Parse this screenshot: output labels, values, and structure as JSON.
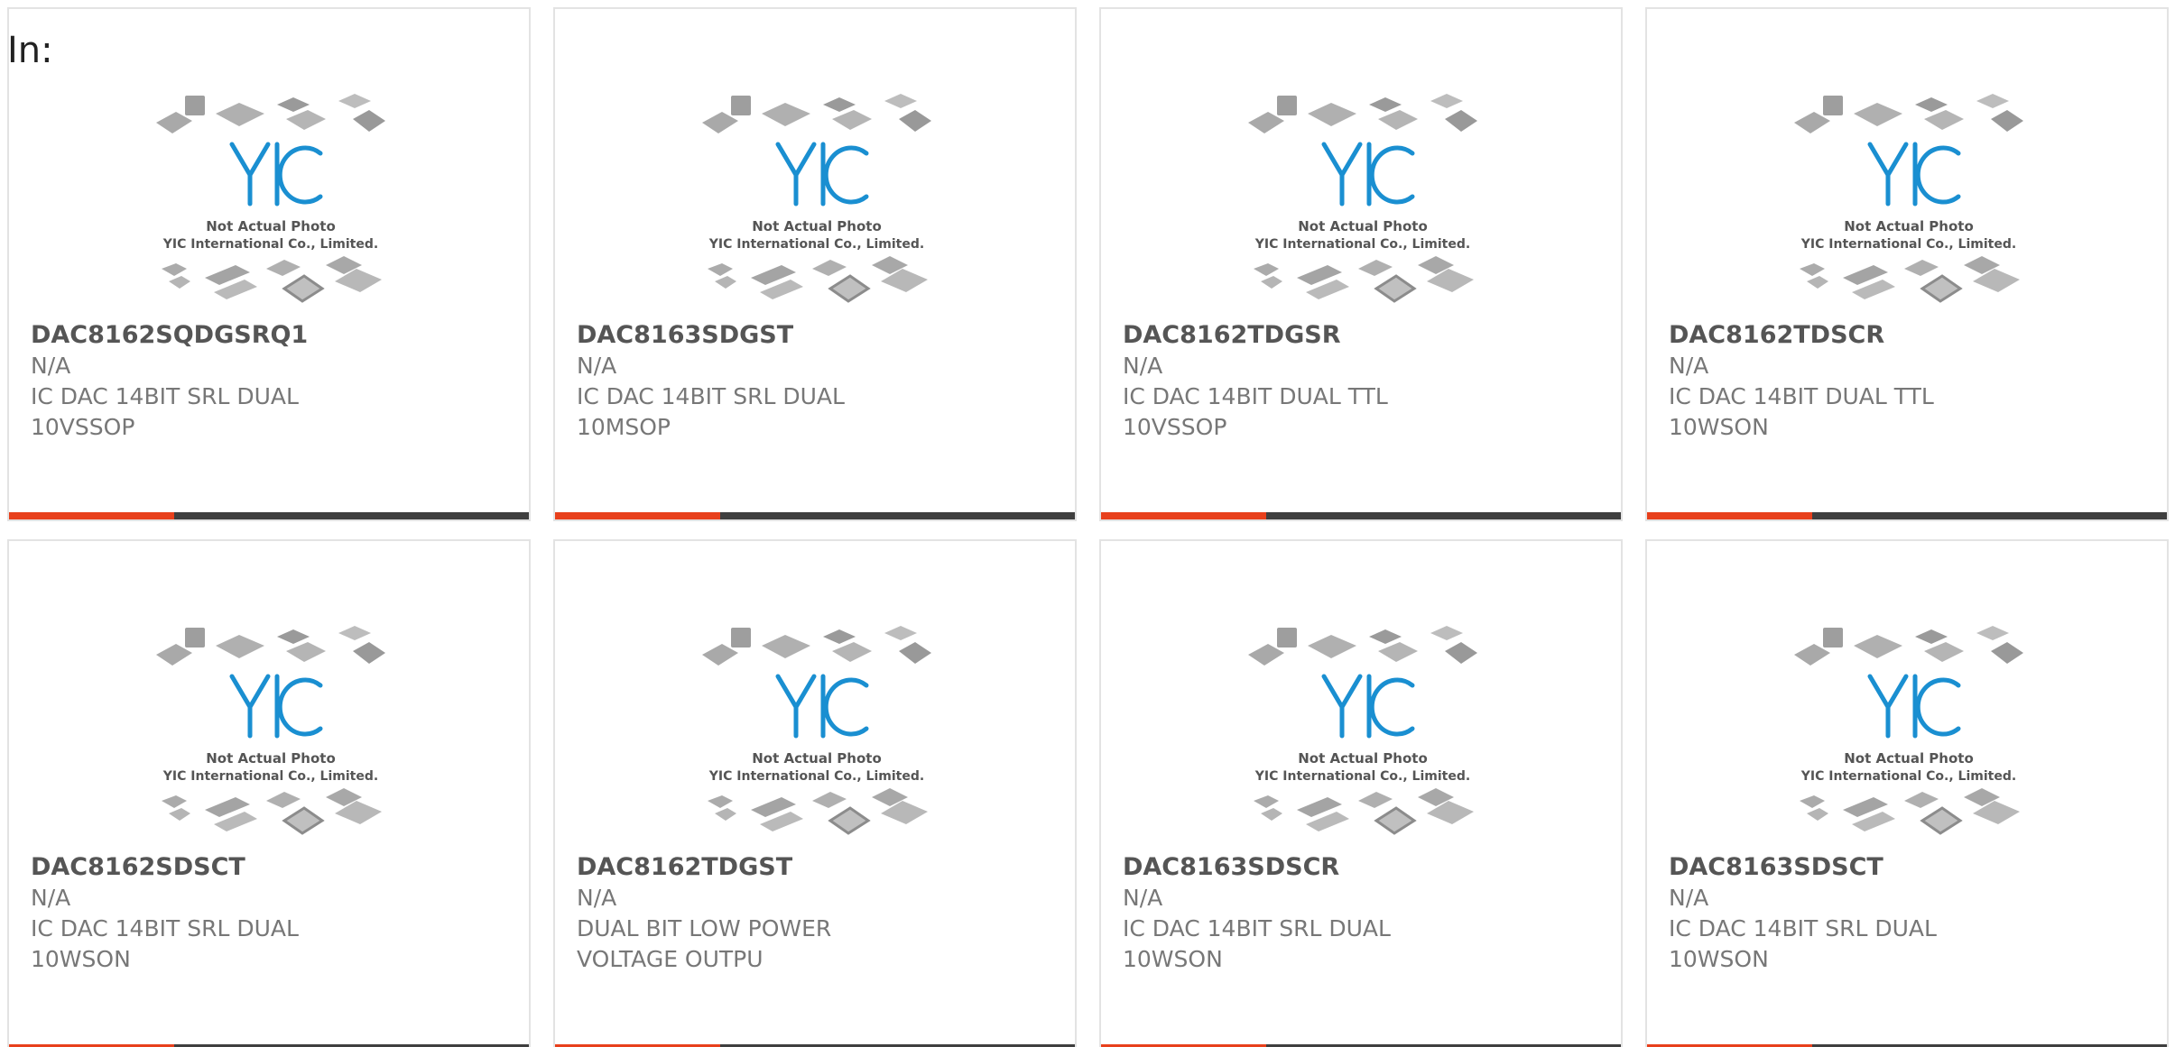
{
  "header": {
    "label": "In:"
  },
  "photo": {
    "caption_line1": "Not Actual Photo",
    "caption_line2": "YIC International Co., Limited.",
    "logo_icon": "yic-logo-icon",
    "logo_color": "#1a8fd1"
  },
  "colors": {
    "accent": "#e8401c",
    "bar": "#3f3f3f",
    "border": "#e3e3e3",
    "text": "#777777"
  },
  "products": [
    {
      "part_no": "DAC8162SQDGSRQ1",
      "manufacturer": "N/A",
      "description": "IC DAC 14BIT SRL DUAL 10VSSOP"
    },
    {
      "part_no": "DAC8163SDGST",
      "manufacturer": "N/A",
      "description": "IC DAC 14BIT SRL DUAL 10MSOP"
    },
    {
      "part_no": "DAC8162TDGSR",
      "manufacturer": "N/A",
      "description": "IC DAC 14BIT DUAL TTL 10VSSOP"
    },
    {
      "part_no": "DAC8162TDSCR",
      "manufacturer": "N/A",
      "description": "IC DAC 14BIT DUAL TTL 10WSON"
    },
    {
      "part_no": "DAC8162SDSCT",
      "manufacturer": "N/A",
      "description": "IC DAC 14BIT SRL DUAL 10WSON"
    },
    {
      "part_no": "DAC8162TDGST",
      "manufacturer": "N/A",
      "description": "DUAL BIT LOW POWER VOLTAGE OUTPU"
    },
    {
      "part_no": "DAC8163SDSCR",
      "manufacturer": "N/A",
      "description": "IC DAC 14BIT SRL DUAL 10WSON"
    },
    {
      "part_no": "DAC8163SDSCT",
      "manufacturer": "N/A",
      "description": "IC DAC 14BIT SRL DUAL 10WSON"
    }
  ]
}
